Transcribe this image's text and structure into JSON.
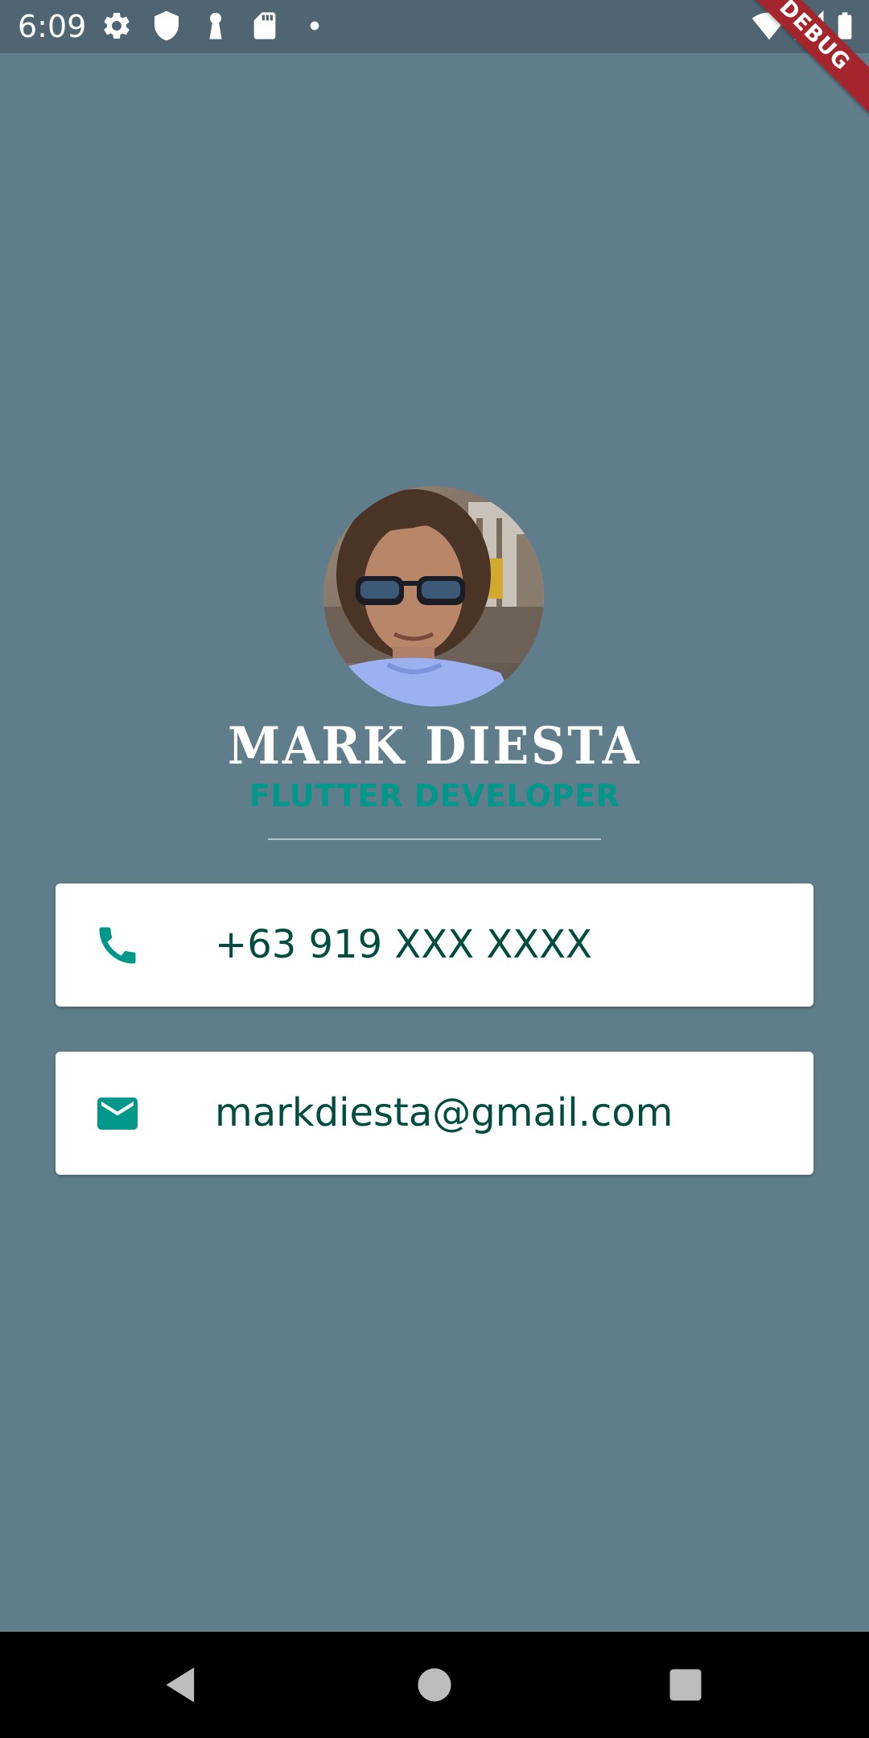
{
  "status_bar": {
    "time": "6:09",
    "left_icons": [
      "gear-icon",
      "shield-icon",
      "keyhole-icon",
      "sd-card-icon",
      "dot-icon"
    ],
    "right_icons": [
      "wifi-icon",
      "signal-icon",
      "battery-icon"
    ]
  },
  "debug_banner": "DEBUG",
  "profile": {
    "name": "MARK DIESTA",
    "title": "FLUTTER DEVELOPER"
  },
  "contacts": {
    "phone": "+63 919 XXX XXXX",
    "email": "markdiesta@gmail.com"
  },
  "nav_bar": {
    "buttons": [
      "back-icon",
      "home-icon",
      "recents-icon"
    ]
  },
  "colors": {
    "background": "#607D8B",
    "status_bar": "#4F6672",
    "accent_teal": "#00988A",
    "contact_text": "#004D40",
    "card": "#FFFFFF",
    "debug_banner": "#A4262C"
  }
}
